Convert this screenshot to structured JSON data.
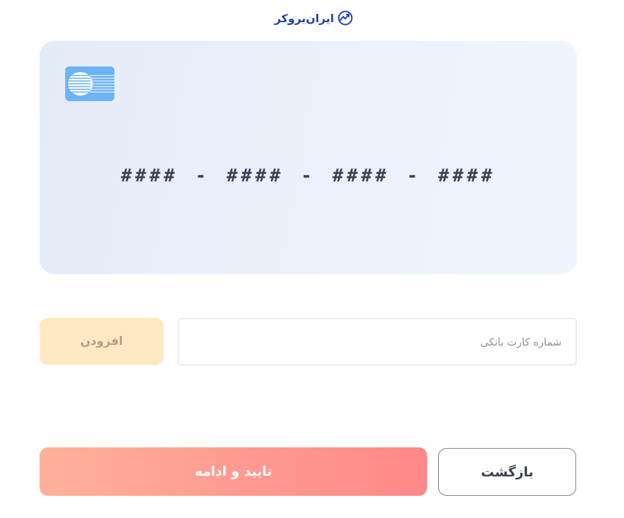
{
  "brand": {
    "name": "ایران‌بروکر",
    "color": "#1f3fb2",
    "icon": "trend-chart-icon"
  },
  "card_preview": {
    "number_mask": "#### - #### - #### - ####",
    "chip_icon": "card-chip-icon",
    "chip_color": "#6db3f5"
  },
  "card_entry": {
    "value": "",
    "placeholder": "شماره کارت بانکی",
    "add_label": "افزودن",
    "add_enabled": false
  },
  "actions": {
    "confirm_label": "تایید و ادامه",
    "back_label": "بازگشت",
    "confirm_gradient": [
      "#ffb19b",
      "#ff8888"
    ]
  }
}
